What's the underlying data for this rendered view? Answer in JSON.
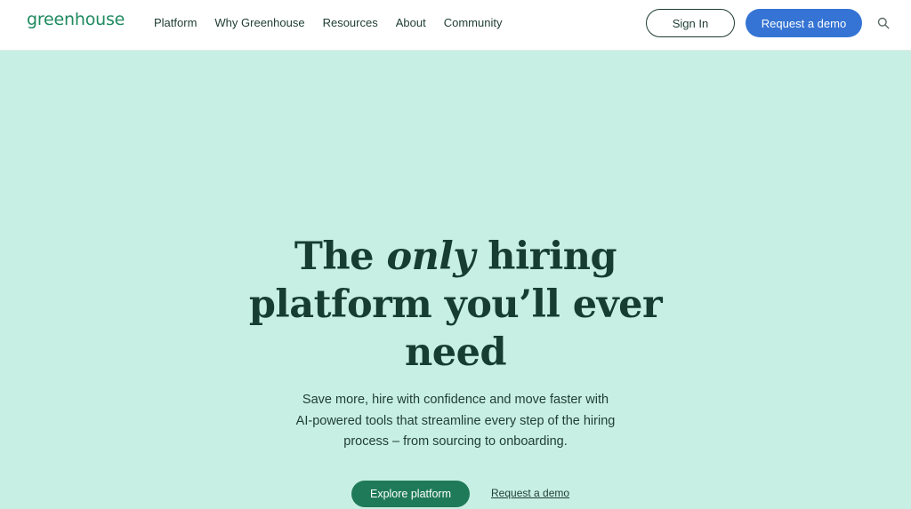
{
  "header": {
    "logo_text": "greenhouse",
    "nav": [
      {
        "label": "Platform"
      },
      {
        "label": "Why Greenhouse"
      },
      {
        "label": "Resources"
      },
      {
        "label": "About"
      },
      {
        "label": "Community"
      }
    ],
    "sign_in_label": "Sign In",
    "request_demo_label": "Request a demo",
    "search_icon": "search-icon"
  },
  "hero": {
    "headline_before": "The ",
    "headline_emphasis": "only",
    "headline_after": " hiring platform you’ll ever need",
    "description": "Save more, hire with confidence and move faster with AI-powered tools that streamline every step of the hiring process – from sourcing to onboarding.",
    "primary_cta": "Explore platform",
    "secondary_cta": "Request a demo"
  },
  "colors": {
    "hero_background": "#c8efe3",
    "brand_green": "#1f8a5f",
    "primary_blue": "#3574d4",
    "button_green": "#1f7a5a",
    "text_dark": "#173c31"
  }
}
